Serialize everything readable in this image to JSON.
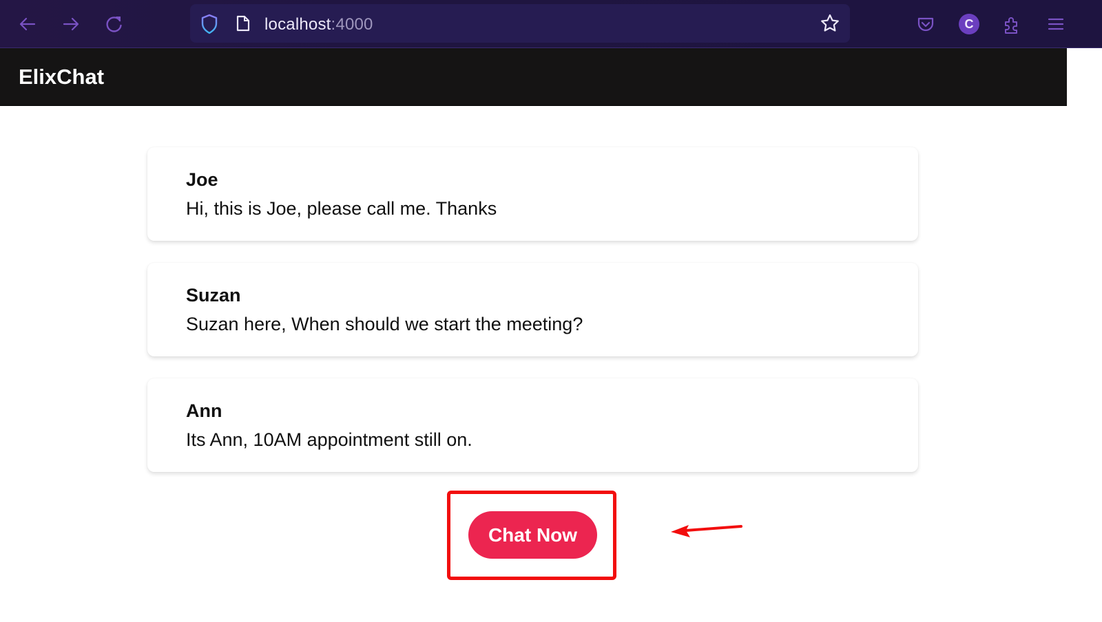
{
  "browser": {
    "url_host": "localhost",
    "url_port": ":4000",
    "profile_initial": "C",
    "icons": [
      "back-arrow-icon",
      "forward-arrow-icon",
      "reload-icon",
      "shield-icon",
      "page-icon",
      "star-icon",
      "pocket-icon",
      "profile-icon",
      "extensions-icon",
      "menu-icon"
    ]
  },
  "app": {
    "title": "ElixChat"
  },
  "messages": [
    {
      "name": "Joe",
      "text": "Hi, this is Joe, please call me. Thanks"
    },
    {
      "name": "Suzan",
      "text": "Suzan here, When should we start the meeting?"
    },
    {
      "name": "Ann",
      "text": "Its Ann, 10AM appointment still on."
    }
  ],
  "actions": {
    "chat_now_label": "Chat Now"
  },
  "colors": {
    "toolbar_bg": "#1f1540",
    "header_bg": "#151414",
    "button_bg": "#ec2550",
    "annotation_red": "#f20d0d",
    "icon_purple": "#8a5cd8"
  }
}
